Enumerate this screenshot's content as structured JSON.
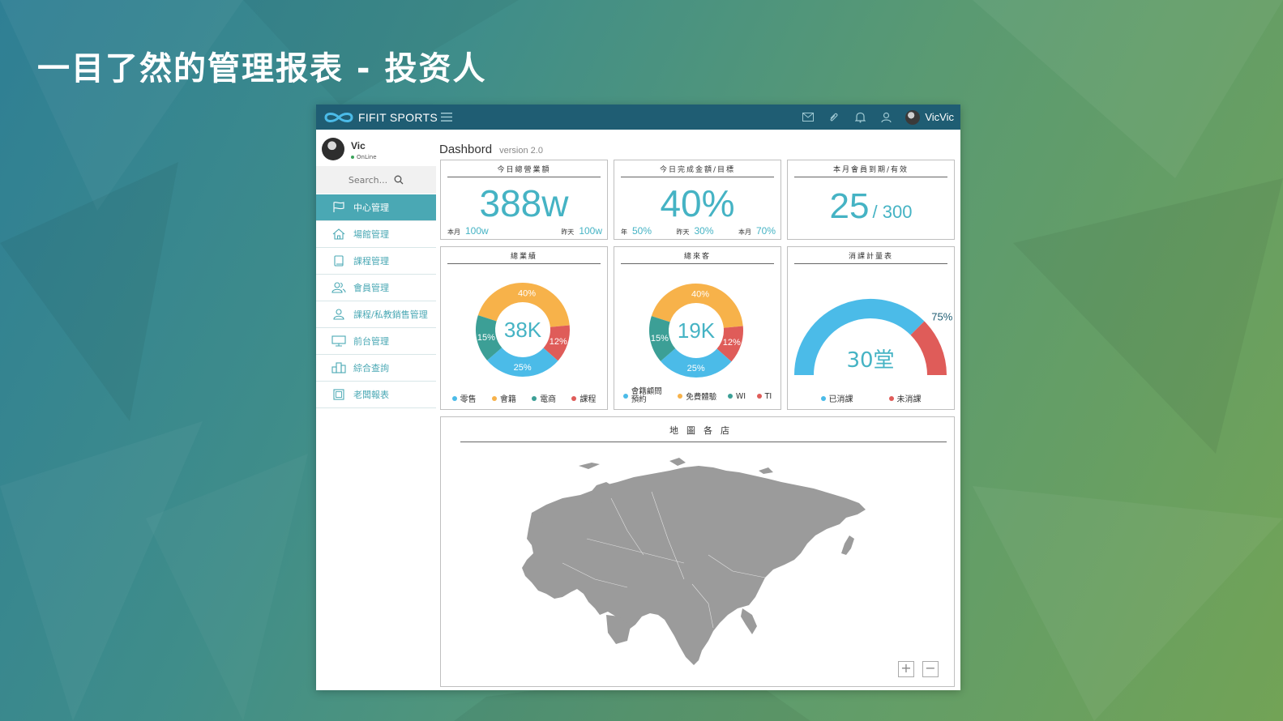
{
  "slide": {
    "title": "一目了然的管理报表 - 投资人"
  },
  "app": {
    "brand": "FIFIT SPORTS",
    "username": "VicVic",
    "top_icons": [
      "mail-icon",
      "paperclip-icon",
      "bell-icon",
      "user-icon"
    ]
  },
  "user": {
    "name": "Vic",
    "status": "OnLine"
  },
  "search": {
    "placeholder": "Search..."
  },
  "nav": [
    {
      "label": "中心管理",
      "icon": "flag-icon",
      "active": true
    },
    {
      "label": "場館管理",
      "icon": "home-icon",
      "active": false
    },
    {
      "label": "課程管理",
      "icon": "book-icon",
      "active": false
    },
    {
      "label": "會員管理",
      "icon": "users-icon",
      "active": false
    },
    {
      "label": "課程/私教銷售管理",
      "icon": "person-icon",
      "active": false
    },
    {
      "label": "前台管理",
      "icon": "monitor-icon",
      "active": false
    },
    {
      "label": "綜合查詢",
      "icon": "buildings-icon",
      "active": false
    },
    {
      "label": "老闆報表",
      "icon": "report-icon",
      "active": false
    }
  ],
  "page": {
    "title": "Dashbord",
    "version": "version 2.0"
  },
  "kpi": [
    {
      "title": "今日總營業額",
      "value": "388w",
      "foot": [
        {
          "label": "本月",
          "value": "100w"
        },
        {
          "label": "昨天",
          "value": "100w"
        }
      ]
    },
    {
      "title": "今日完成金額/目標",
      "value": "40%",
      "foot": [
        {
          "label": "年",
          "value": "50%"
        },
        {
          "label": "昨天",
          "value": "30%"
        },
        {
          "label": "本月",
          "value": "70%"
        }
      ]
    },
    {
      "title": "本月會員到期/有效",
      "value": "25",
      "total": "/ 300"
    }
  ],
  "colors": {
    "blue": "#4bbbe8",
    "orange": "#f7b24a",
    "teal": "#3c9f96",
    "red": "#df5c59",
    "accent": "#45b3c4",
    "topbar": "#1f5d73"
  },
  "chart_data": [
    {
      "type": "pie",
      "title": "總業績",
      "center": "38K",
      "categories": [
        "零售",
        "會籍",
        "電商",
        "課程"
      ],
      "slices": [
        {
          "label": "40%",
          "value": 40
        },
        {
          "label": "12%",
          "value": 12
        },
        {
          "label": "25%",
          "value": 25
        },
        {
          "label": "15%",
          "value": 15
        }
      ]
    },
    {
      "type": "pie",
      "title": "總來客",
      "center": "19K",
      "categories": [
        "會籍顧問預約",
        "免費體驗",
        "WI",
        "TI"
      ],
      "slices": [
        {
          "label": "40%",
          "value": 40
        },
        {
          "label": "12%",
          "value": 12
        },
        {
          "label": "25%",
          "value": 25
        },
        {
          "label": "15%",
          "value": 15
        }
      ]
    },
    {
      "type": "pie",
      "title": "消課計量表",
      "center": "30堂",
      "categories": [
        "已消課",
        "未消課"
      ],
      "slices": [
        {
          "label": "75%",
          "value": 75
        },
        {
          "label": "",
          "value": 25
        }
      ]
    }
  ],
  "map": {
    "title": "地圖各店",
    "zoom_in": "+",
    "zoom_out": "−"
  }
}
